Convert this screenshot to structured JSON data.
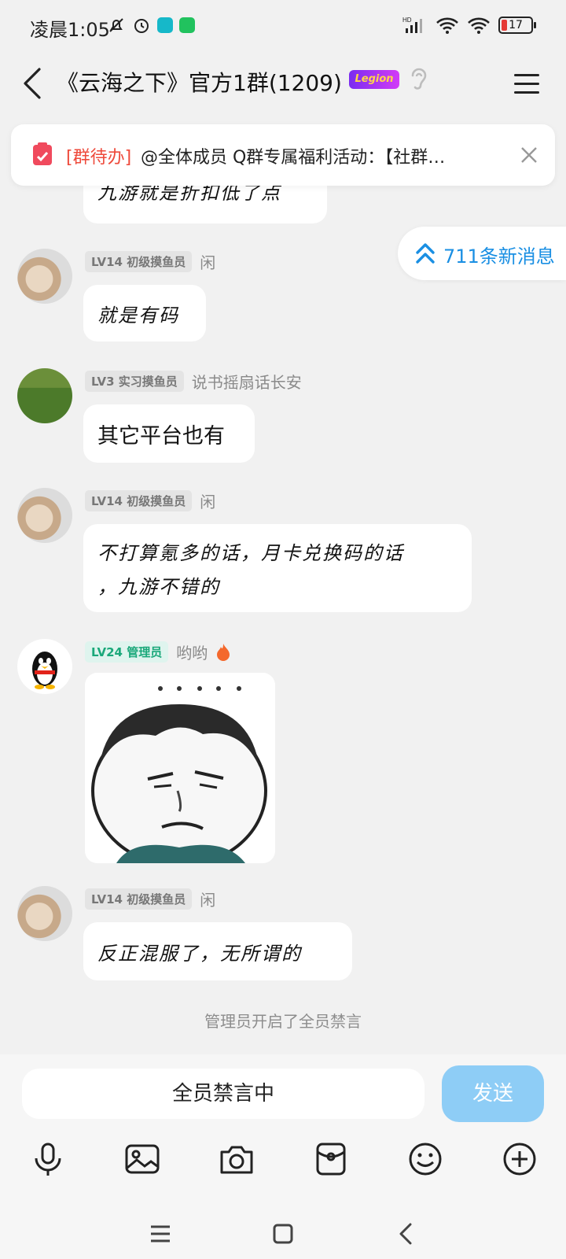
{
  "status_bar": {
    "time": "凌晨1:05",
    "battery": "17",
    "icons": [
      "mute-bell-icon",
      "alarm-icon",
      "upload-app-icon",
      "bot-app-icon",
      "hd-signal-icon",
      "wifi-icon",
      "wifi-icon",
      "battery-icon"
    ]
  },
  "header": {
    "title": "《云海之下》官方1群(1209)",
    "badge": "Legion"
  },
  "todo": {
    "tag": "[群待办]",
    "text": "@全体成员  Q群专属福利活动：【社群…"
  },
  "new_messages": {
    "label": "711条新消息"
  },
  "messages": [
    {
      "text": "九游就是折扣低了点"
    },
    {
      "level": "LV14 初级摸鱼员",
      "nick": "闲",
      "text": "就是有码"
    },
    {
      "level": "LV3 实习摸鱼员",
      "nick": "说书摇扇话长安",
      "text": "其它平台也有"
    },
    {
      "level": "LV14 初级摸鱼员",
      "nick": "闲",
      "text_line1": "不打算氪多的话，月卡兑换码的话",
      "text_line2": "，九游不错的"
    },
    {
      "level": "LV24 管理员",
      "nick": "哟哟"
    },
    {
      "level": "LV14 初级摸鱼员",
      "nick": "闲",
      "text": "反正混服了，无所谓的"
    }
  ],
  "system_message": "管理员开启了全员禁言",
  "input": {
    "muted_text": "全员禁言中",
    "send_label": "发送"
  },
  "colors": {
    "accent_blue": "#1a8fe3",
    "todo_red": "#ee4a3b",
    "admin_green": "#1aa87a",
    "send_disabled": "#8ecdf6"
  }
}
